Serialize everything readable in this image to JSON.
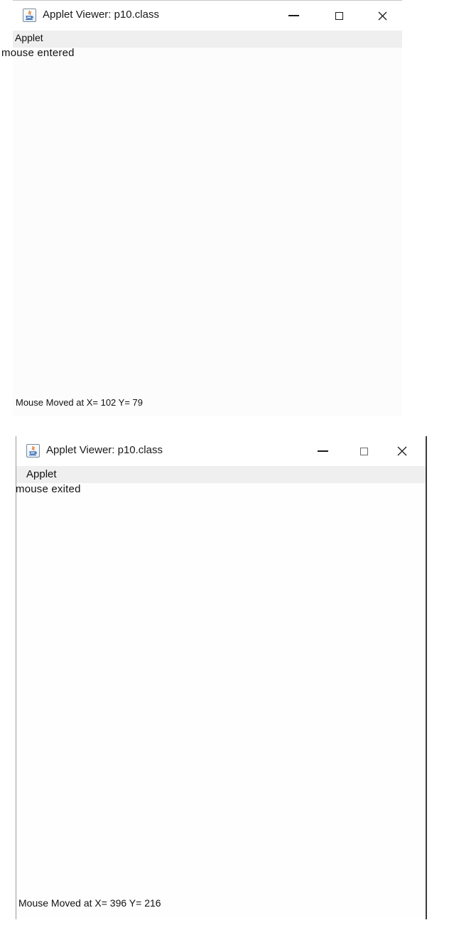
{
  "windows": [
    {
      "title": "Applet Viewer: p10.class",
      "icon": "java-applet-icon",
      "controls": {
        "minimize": "–",
        "maximize": "□",
        "close": "✕"
      },
      "menu": {
        "label": "Applet"
      },
      "event_message": "mouse entered",
      "status_message": "Mouse Moved at X= 102 Y= 79"
    },
    {
      "title": "Applet Viewer: p10.class",
      "icon": "java-applet-icon",
      "controls": {
        "minimize": "–",
        "maximize": "□",
        "close": "✕"
      },
      "menu": {
        "label": "Applet"
      },
      "event_message": "mouse exited",
      "status_message": "Mouse Moved at X= 396 Y= 216"
    }
  ],
  "colors": {
    "menubar": "#efefef",
    "canvas": "#fcfcfc",
    "text": "#111111"
  }
}
